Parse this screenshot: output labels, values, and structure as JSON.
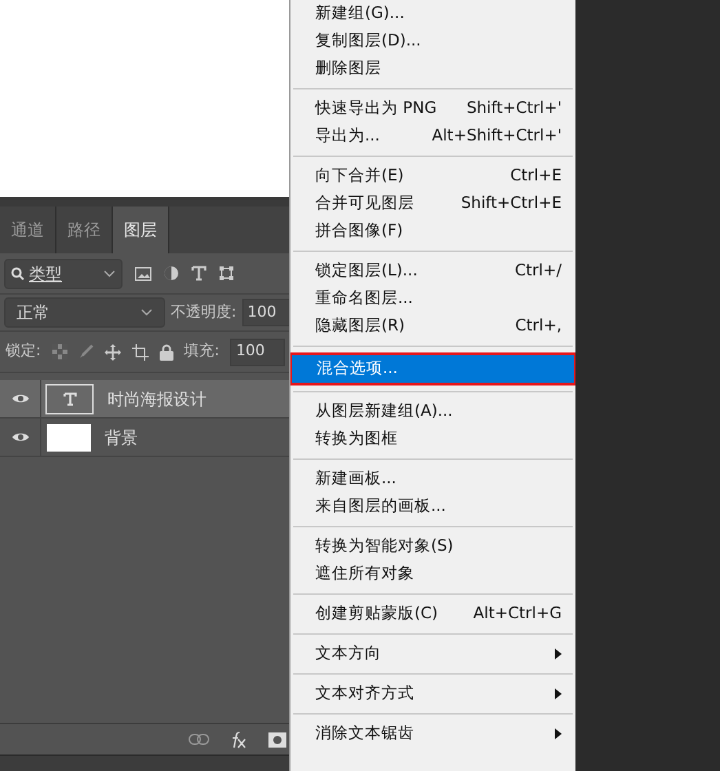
{
  "panel": {
    "tabs": [
      {
        "label": "通道",
        "selected": false
      },
      {
        "label": "路径",
        "selected": false
      },
      {
        "label": "图层",
        "selected": true
      }
    ],
    "filter": {
      "value": "类型"
    },
    "blend_mode": "正常",
    "opacity_label": "不透明度:",
    "opacity": "100",
    "lock_label": "锁定:",
    "fill_label": "填充:",
    "fill": "100",
    "layers": [
      {
        "name": "时尚海报设计",
        "kind": "text",
        "visible": true,
        "selected": true
      },
      {
        "name": "背景",
        "kind": "image",
        "visible": true,
        "selected": false
      }
    ]
  },
  "menu": [
    {
      "kind": "item",
      "label": "新建组(G)...",
      "selected": false
    },
    {
      "kind": "item",
      "label": "复制图层(D)...",
      "selected": false
    },
    {
      "kind": "item",
      "label": "删除图层",
      "selected": false
    },
    {
      "kind": "separator"
    },
    {
      "kind": "item",
      "label": "快速导出为 PNG",
      "shortcut": "Shift+Ctrl+'",
      "selected": false
    },
    {
      "kind": "item",
      "label": "导出为...",
      "shortcut": "Alt+Shift+Ctrl+'",
      "selected": false
    },
    {
      "kind": "separator"
    },
    {
      "kind": "item",
      "label": "向下合并(E)",
      "shortcut": "Ctrl+E",
      "selected": false
    },
    {
      "kind": "item",
      "label": "合并可见图层",
      "shortcut": "Shift+Ctrl+E",
      "selected": false
    },
    {
      "kind": "item",
      "label": "拼合图像(F)",
      "selected": false
    },
    {
      "kind": "separator"
    },
    {
      "kind": "item",
      "label": "锁定图层(L)...",
      "shortcut": "Ctrl+/",
      "selected": false
    },
    {
      "kind": "item",
      "label": "重命名图层...",
      "selected": false
    },
    {
      "kind": "item",
      "label": "隐藏图层(R)",
      "shortcut": "Ctrl+,",
      "selected": false
    },
    {
      "kind": "separator"
    },
    {
      "kind": "item",
      "label": "混合选项...",
      "selected": true
    },
    {
      "kind": "separator"
    },
    {
      "kind": "item",
      "label": "从图层新建组(A)...",
      "selected": false
    },
    {
      "kind": "item",
      "label": "转换为图框",
      "selected": false
    },
    {
      "kind": "separator"
    },
    {
      "kind": "item",
      "label": "新建画板...",
      "selected": false
    },
    {
      "kind": "item",
      "label": "来自图层的画板...",
      "selected": false
    },
    {
      "kind": "separator"
    },
    {
      "kind": "item",
      "label": "转换为智能对象(S)",
      "selected": false
    },
    {
      "kind": "item",
      "label": "遮住所有对象",
      "selected": false
    },
    {
      "kind": "separator"
    },
    {
      "kind": "item",
      "label": "创建剪贴蒙版(C)",
      "shortcut": "Alt+Ctrl+G",
      "selected": false
    },
    {
      "kind": "separator"
    },
    {
      "kind": "submenu",
      "label": "文本方向",
      "selected": false
    },
    {
      "kind": "separator"
    },
    {
      "kind": "submenu",
      "label": "文本对齐方式",
      "selected": false
    },
    {
      "kind": "separator"
    },
    {
      "kind": "submenu",
      "label": "消除文本锯齿",
      "selected": false
    }
  ]
}
